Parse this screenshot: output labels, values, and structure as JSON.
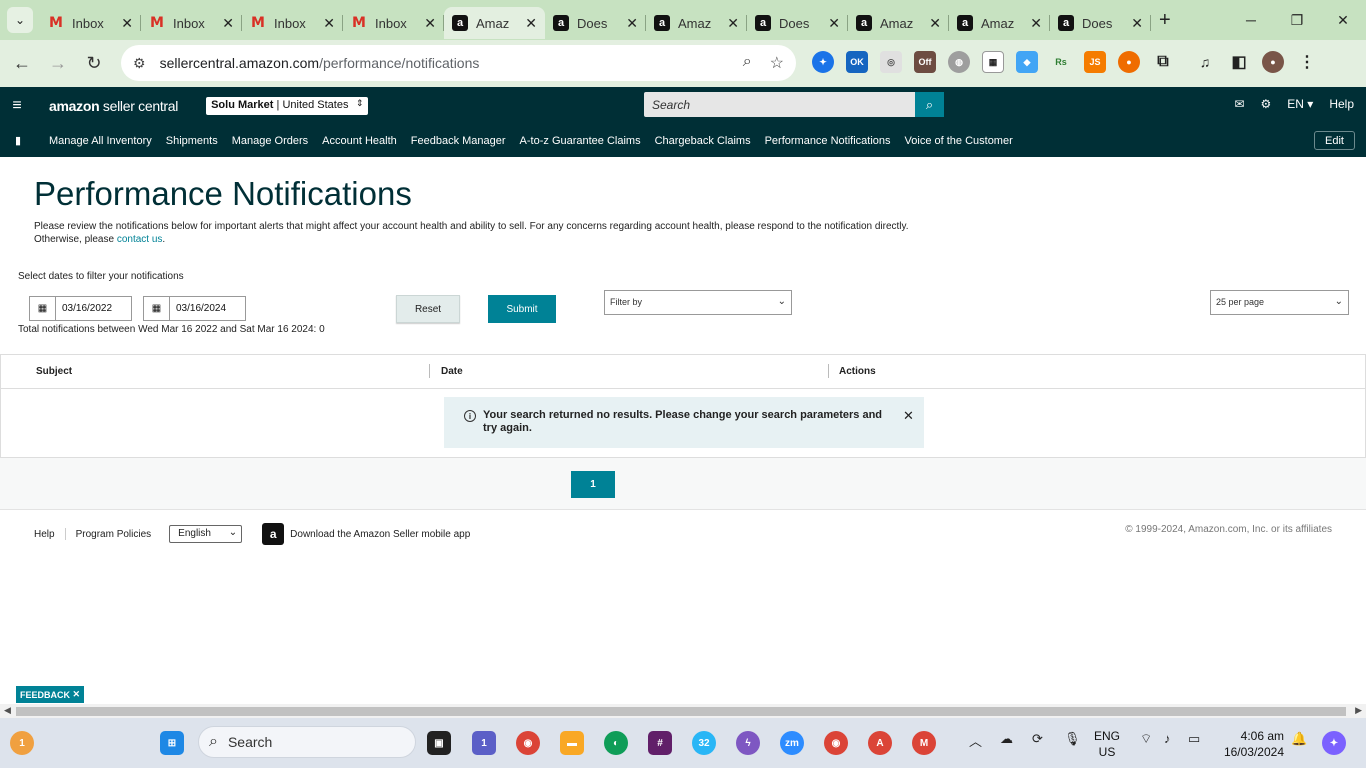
{
  "browser": {
    "tabs": [
      {
        "favicon": "gmail",
        "title": "Inbox"
      },
      {
        "favicon": "gmail",
        "title": "Inbox"
      },
      {
        "favicon": "gmail",
        "title": "Inbox"
      },
      {
        "favicon": "gmail",
        "title": "Inbox"
      },
      {
        "favicon": "amazon",
        "title": "Amaz",
        "active": true
      },
      {
        "favicon": "amazon",
        "title": "Does"
      },
      {
        "favicon": "amazon",
        "title": "Amaz"
      },
      {
        "favicon": "amazon",
        "title": "Does"
      },
      {
        "favicon": "amazon-smile",
        "title": "Amaz"
      },
      {
        "favicon": "amazon",
        "title": "Amaz"
      },
      {
        "favicon": "amazon",
        "title": "Does"
      }
    ],
    "url_domain": "sellercentral.amazon.com",
    "url_path": "/performance/notifications",
    "extension_badges": {
      "ok": "OK",
      "off": "Off",
      "rs": "Rs",
      "js": "JS"
    }
  },
  "header": {
    "logo_bold": "amazon",
    "logo_rest": " seller central",
    "store_name": "Solu Market",
    "store_sep": " | ",
    "store_region": "United States",
    "search_placeholder": "Search",
    "lang": "EN",
    "help": "Help"
  },
  "nav": {
    "items": [
      "Manage All Inventory",
      "Shipments",
      "Manage Orders",
      "Account Health",
      "Feedback Manager",
      "A-to-z Guarantee Claims",
      "Chargeback Claims",
      "Performance Notifications",
      "Voice of the Customer"
    ],
    "edit": "Edit"
  },
  "page": {
    "title": "Performance Notifications",
    "description_1": "Please review the notifications below for important alerts that might affect your account health and ability to sell. For any concerns regarding account health, please respond to the notification directly.",
    "description_2": "Otherwise, please ",
    "contact_link": "contact us",
    "description_end": "."
  },
  "filters": {
    "label": "Select dates to filter your notifications",
    "start_date": "03/16/2022",
    "end_date": "03/16/2024",
    "reset": "Reset",
    "submit": "Submit",
    "filter_by": "Filter by",
    "per_page": "25 per page",
    "total": "Total notifications between Wed Mar 16 2022 and Sat Mar 16 2024: 0"
  },
  "table": {
    "columns": [
      "Subject",
      "Date",
      "Actions"
    ],
    "empty_message": "Your search returned no results. Please change your search parameters and try again."
  },
  "pager": {
    "current": "1"
  },
  "footer": {
    "help": "Help",
    "policies": "Program Policies",
    "language": "English",
    "app_text": "Download the Amazon Seller mobile app",
    "copyright": "© 1999-2024, Amazon.com, Inc. or its affiliates"
  },
  "feedback": "FEEDBACK",
  "taskbar": {
    "search": "Search",
    "badges": {
      "weather": "1",
      "teams": "1",
      "telegram": "32",
      "chrome_a": "A",
      "chrome_m": "M"
    },
    "zoom": "zm",
    "lang_1": "ENG",
    "lang_2": "US",
    "time": "4:06 am",
    "date": "16/03/2024"
  },
  "colors": {
    "teal": "#008296",
    "dark": "#002f36",
    "chrome_green": "#c7e2c1"
  }
}
